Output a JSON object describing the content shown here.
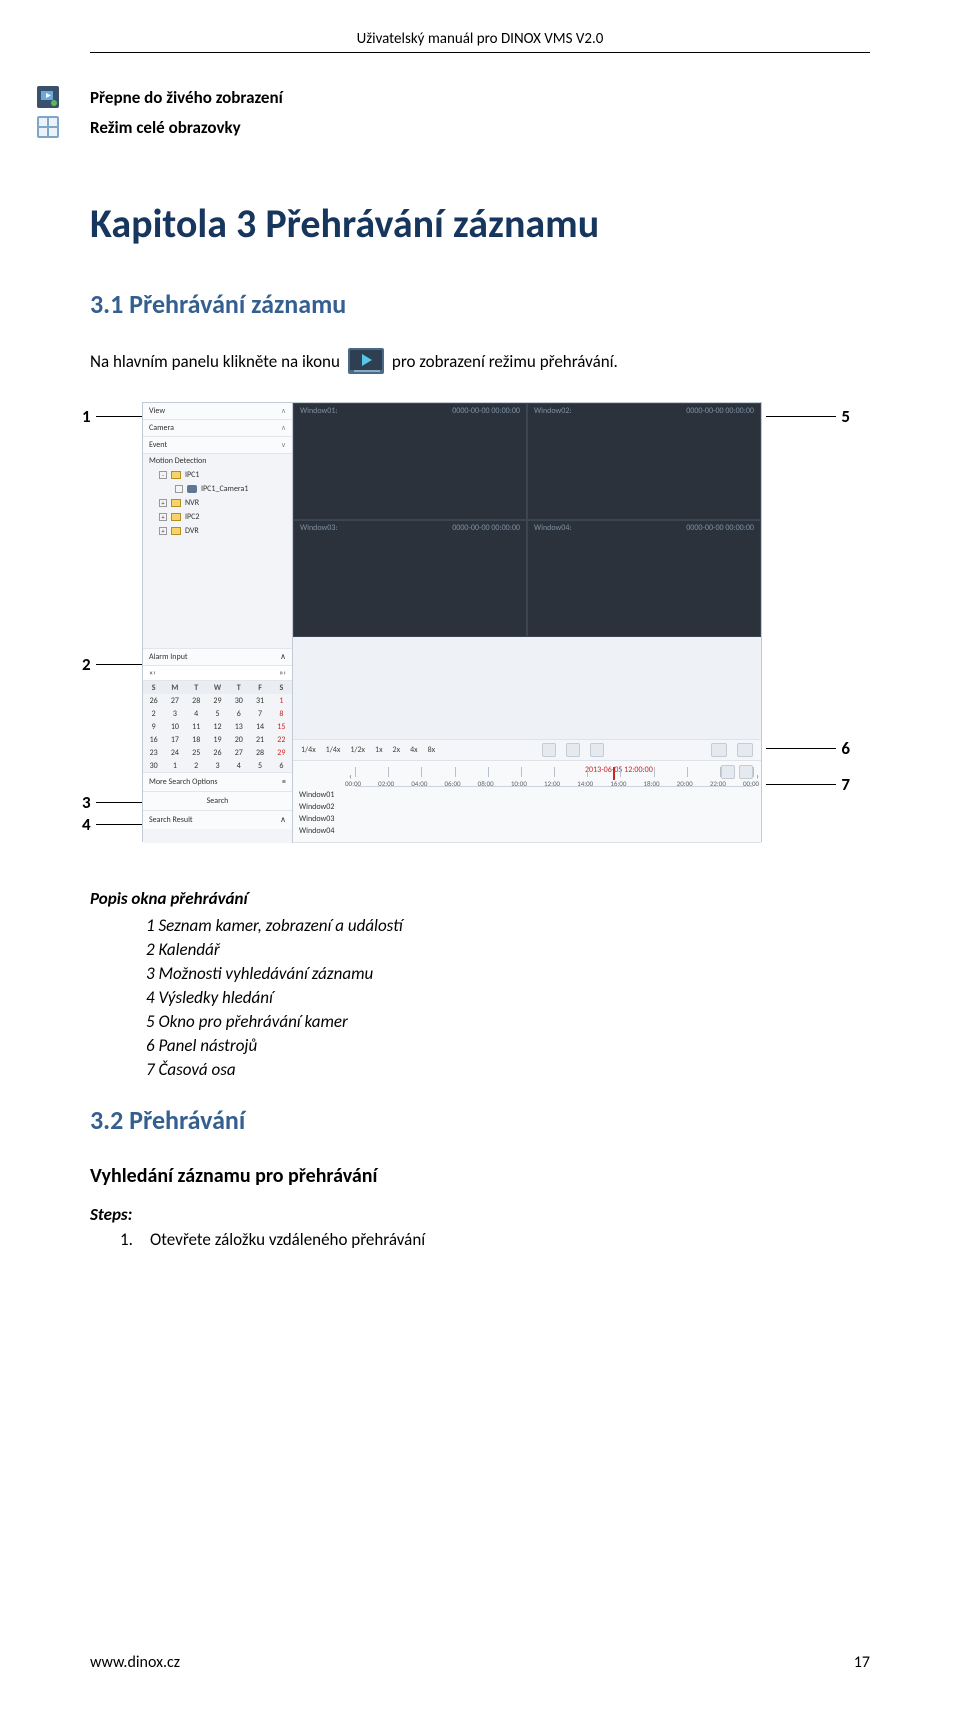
{
  "header": {
    "title": "Uživatelský manuál pro DINOX VMS V2.0"
  },
  "icon_text": {
    "live": "Přepne do živého zobrazení",
    "fullscreen": "Režim celé obrazovky"
  },
  "chapter_title": "Kapitola 3 Přehrávání záznamu",
  "section_3_1_title": "3.1 Přehrávání záznamu",
  "section_3_1_text_a": "Na hlavním panelu klikněte na ikonu",
  "section_3_1_text_b": "pro zobrazení režimu přehrávání.",
  "section_3_2_title": "3.2 Přehrávání",
  "sub_heading": "Vyhledání záznamu pro přehrávání",
  "steps_label": "Steps:",
  "step_1": {
    "num": "1.",
    "text": "Otevřete záložku vzdáleného přehrávání"
  },
  "list_heading": "Popis okna přehrávání",
  "list_items": {
    "1": "1 Seznam kamer, zobrazení a událostí",
    "2": "2 Kalendář",
    "3": "3 Možnosti vyhledávání záznamu",
    "4": "4 Výsledky hledání",
    "5": "5 Okno pro přehrávání kamer",
    "6": "6 Panel nástrojů",
    "7": "7 Časová osa"
  },
  "screenshot": {
    "sidebar": {
      "view": "View",
      "camera": "Camera",
      "event": "Event",
      "motion": "Motion Detection",
      "tree": [
        "IPC1",
        "IPC1_Camera1",
        "NVR",
        "IPC2",
        "DVR"
      ],
      "alarm": "Alarm Input",
      "cal_nav": [
        "«",
        "‹",
        "»",
        "›"
      ],
      "cal_head": [
        "S",
        "M",
        "T",
        "W",
        "T",
        "F",
        "S"
      ],
      "cal_rows": [
        [
          "26",
          "27",
          "28",
          "29",
          "30",
          "31",
          "1"
        ],
        [
          "2",
          "3",
          "4",
          "5",
          "6",
          "7",
          "8"
        ],
        [
          "9",
          "10",
          "11",
          "12",
          "13",
          "14",
          "15"
        ],
        [
          "16",
          "17",
          "18",
          "19",
          "20",
          "21",
          "22"
        ],
        [
          "23",
          "24",
          "25",
          "26",
          "27",
          "28",
          "29"
        ],
        [
          "30",
          "1",
          "2",
          "3",
          "4",
          "5",
          "6"
        ]
      ],
      "more_search": "More Search Options",
      "search_btn": "Search",
      "search_result": "Search Result"
    },
    "video": {
      "w1": "Window01:",
      "w2": "Window02:",
      "w3": "Window03:",
      "w4": "Window04:",
      "ts": "0000-00-00 00:00:00"
    },
    "speed": {
      "items": [
        "1/4x",
        "1/4x",
        "1/2x",
        "1x",
        "2x",
        "4x",
        "8x"
      ]
    },
    "timeline": {
      "cursor_label": "2013-06-05 12:00:00",
      "hours": [
        "00:00",
        "02:00",
        "04:00",
        "06:00",
        "08:00",
        "10:00",
        "12:00",
        "14:00",
        "16:00",
        "18:00",
        "20:00",
        "22:00",
        "00:00"
      ],
      "windows": [
        "Window01",
        "Window02",
        "Window03",
        "Window04"
      ]
    }
  },
  "annotations": {
    "1": "1",
    "2": "2",
    "3": "3",
    "4": "4",
    "5": "5",
    "6": "6",
    "7": "7"
  },
  "footer": {
    "url": "www.dinox.cz",
    "page": "17"
  }
}
